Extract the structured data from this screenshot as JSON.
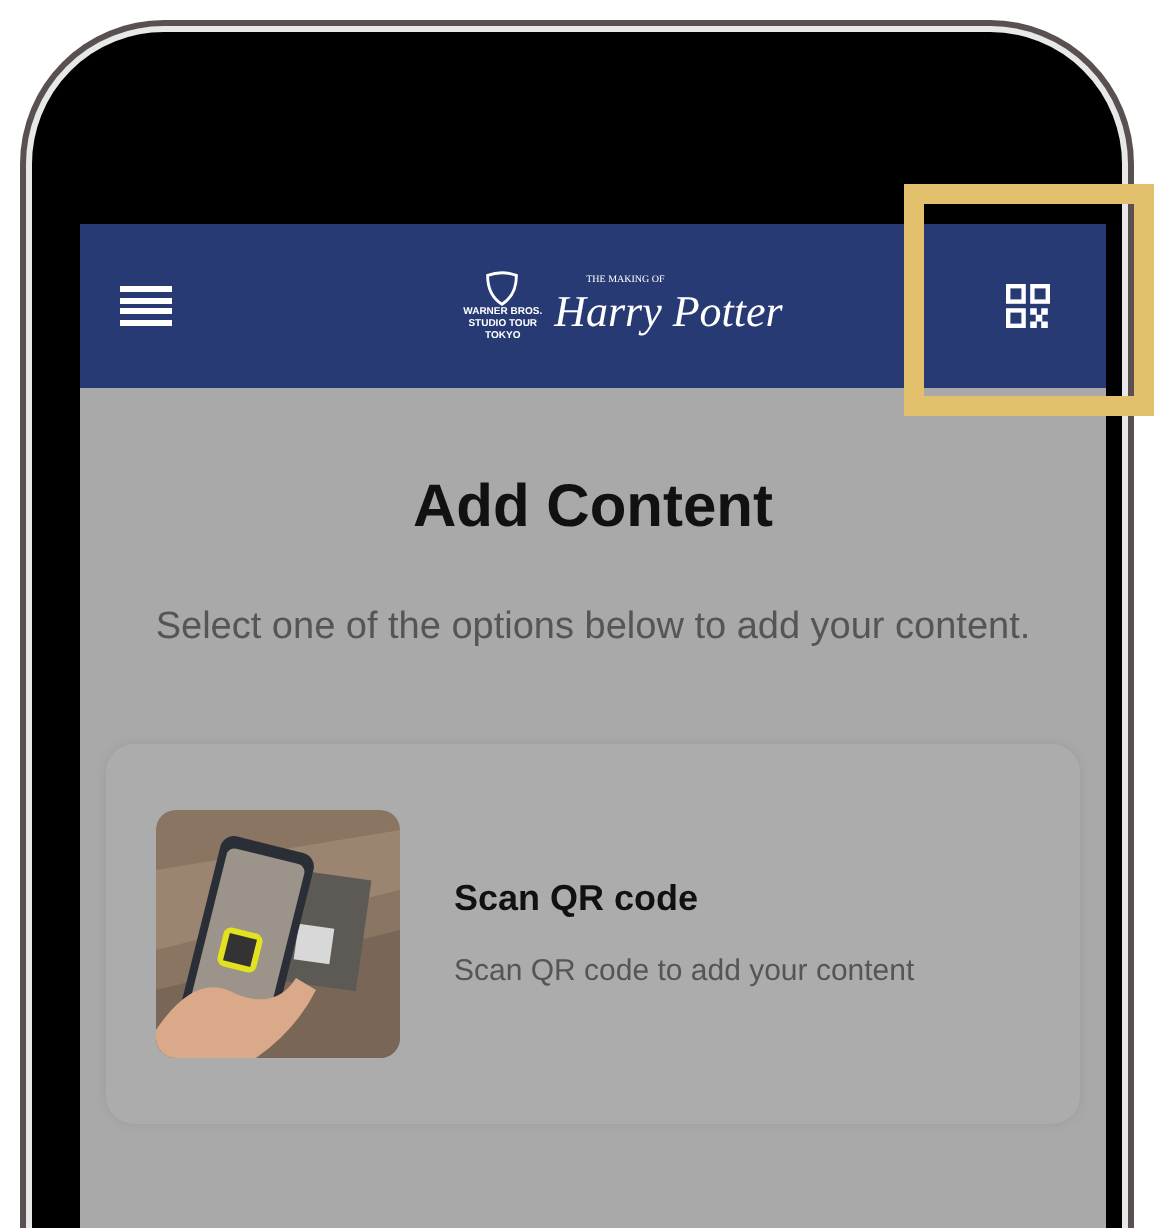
{
  "navbar": {
    "logo": {
      "studio_lines": [
        "WARNER BROS.",
        "STUDIO TOUR",
        "TOKYO"
      ],
      "overline": "THE MAKING OF",
      "title": "Harry Potter"
    }
  },
  "highlight": {
    "on": true
  },
  "page": {
    "title": "Add Content",
    "subtitle": "Select one of the options below to add your content."
  },
  "options": [
    {
      "kind": "picture",
      "title": "Scan QR code",
      "description": "Scan QR code to add your content"
    }
  ]
}
